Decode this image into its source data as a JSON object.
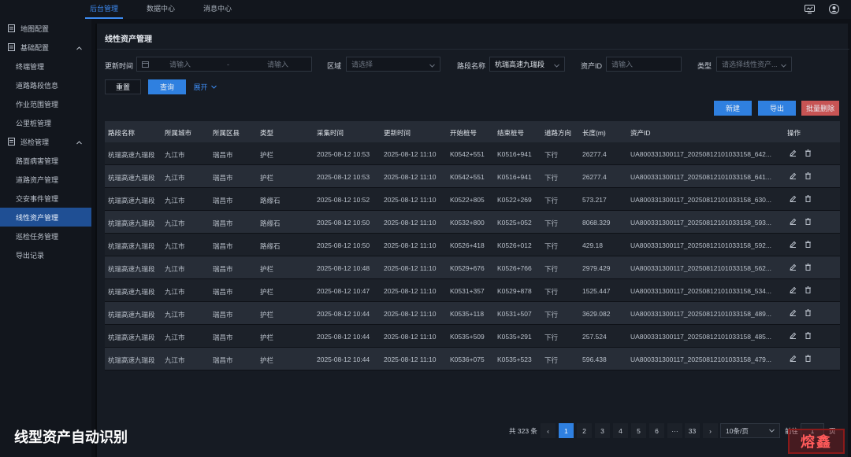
{
  "topnav": {
    "tabs": [
      "后台管理",
      "数据中心",
      "消息中心"
    ],
    "active": 0
  },
  "sidebar": {
    "items": [
      {
        "label": "地图配置",
        "group": true
      },
      {
        "label": "基础配置",
        "group": true,
        "expanded": true
      },
      {
        "label": "终端管理"
      },
      {
        "label": "道路路段信息"
      },
      {
        "label": "作业范围管理"
      },
      {
        "label": "公里桩管理"
      },
      {
        "label": "巡检管理",
        "group": true,
        "expanded": true
      },
      {
        "label": "路面病害管理"
      },
      {
        "label": "道路资产管理"
      },
      {
        "label": "交安事件管理"
      },
      {
        "label": "线性资产管理",
        "active": true
      },
      {
        "label": "巡检任务管理"
      },
      {
        "label": "导出记录"
      }
    ]
  },
  "page": {
    "title": "线性资产管理"
  },
  "filters": {
    "update_time_label": "更新时间",
    "start_placeholder": "请输入",
    "range_sep": "-",
    "end_placeholder": "请输入",
    "region_label": "区域",
    "region_placeholder": "请选择",
    "section_label": "路段名称",
    "section_value": "杭瑞高速九瑞段",
    "asset_id_label": "资产ID",
    "asset_id_placeholder": "请输入",
    "type_label": "类型",
    "type_placeholder": "请选择线性资产..."
  },
  "actions": {
    "reset": "重置",
    "query": "查询",
    "expand": "展开",
    "create": "新建",
    "export": "导出",
    "batch_delete": "批量删除"
  },
  "table": {
    "headers": [
      "路段名称",
      "所属城市",
      "所属区县",
      "类型",
      "采集时间",
      "更新时间",
      "开始桩号",
      "结束桩号",
      "道路方向",
      "长度(m)",
      "资产ID",
      "操作"
    ],
    "rows": [
      [
        "杭瑞高速九瑞段",
        "九江市",
        "瑞昌市",
        "护栏",
        "2025-08-12 10:53",
        "2025-08-12 11:10",
        "K0542+551",
        "K0516+941",
        "下行",
        "26277.4",
        "UA800331300117_20250812101033158_642..."
      ],
      [
        "杭瑞高速九瑞段",
        "九江市",
        "瑞昌市",
        "护栏",
        "2025-08-12 10:53",
        "2025-08-12 11:10",
        "K0542+551",
        "K0516+941",
        "下行",
        "26277.4",
        "UA800331300117_20250812101033158_641..."
      ],
      [
        "杭瑞高速九瑞段",
        "九江市",
        "瑞昌市",
        "路缘石",
        "2025-08-12 10:52",
        "2025-08-12 11:10",
        "K0522+805",
        "K0522+269",
        "下行",
        "573.217",
        "UA800331300117_20250812101033158_630..."
      ],
      [
        "杭瑞高速九瑞段",
        "九江市",
        "瑞昌市",
        "路缘石",
        "2025-08-12 10:50",
        "2025-08-12 11:10",
        "K0532+800",
        "K0525+052",
        "下行",
        "8068.329",
        "UA800331300117_20250812101033158_593..."
      ],
      [
        "杭瑞高速九瑞段",
        "九江市",
        "瑞昌市",
        "路缘石",
        "2025-08-12 10:50",
        "2025-08-12 11:10",
        "K0526+418",
        "K0526+012",
        "下行",
        "429.18",
        "UA800331300117_20250812101033158_592..."
      ],
      [
        "杭瑞高速九瑞段",
        "九江市",
        "瑞昌市",
        "护栏",
        "2025-08-12 10:48",
        "2025-08-12 11:10",
        "K0529+676",
        "K0526+766",
        "下行",
        "2979.429",
        "UA800331300117_20250812101033158_562..."
      ],
      [
        "杭瑞高速九瑞段",
        "九江市",
        "瑞昌市",
        "护栏",
        "2025-08-12 10:47",
        "2025-08-12 11:10",
        "K0531+357",
        "K0529+878",
        "下行",
        "1525.447",
        "UA800331300117_20250812101033158_534..."
      ],
      [
        "杭瑞高速九瑞段",
        "九江市",
        "瑞昌市",
        "护栏",
        "2025-08-12 10:44",
        "2025-08-12 11:10",
        "K0535+118",
        "K0531+507",
        "下行",
        "3629.082",
        "UA800331300117_20250812101033158_489..."
      ],
      [
        "杭瑞高速九瑞段",
        "九江市",
        "瑞昌市",
        "护栏",
        "2025-08-12 10:44",
        "2025-08-12 11:10",
        "K0535+509",
        "K0535+291",
        "下行",
        "257.524",
        "UA800331300117_20250812101033158_485..."
      ],
      [
        "杭瑞高速九瑞段",
        "九江市",
        "瑞昌市",
        "护栏",
        "2025-08-12 10:44",
        "2025-08-12 11:10",
        "K0536+075",
        "K0535+523",
        "下行",
        "596.438",
        "UA800331300117_20250812101033158_479..."
      ]
    ]
  },
  "pagination": {
    "total": "共 323 条",
    "prev": "‹",
    "pages": [
      "1",
      "2",
      "3",
      "4",
      "5",
      "6"
    ],
    "ellipsis": "···",
    "last": "33",
    "next": "›",
    "page_size": "10条/页",
    "goto_label": "前往",
    "goto_value": "1",
    "goto_suffix": "页"
  },
  "caption": "线型资产自动识别",
  "logo_text": "熔鑫"
}
